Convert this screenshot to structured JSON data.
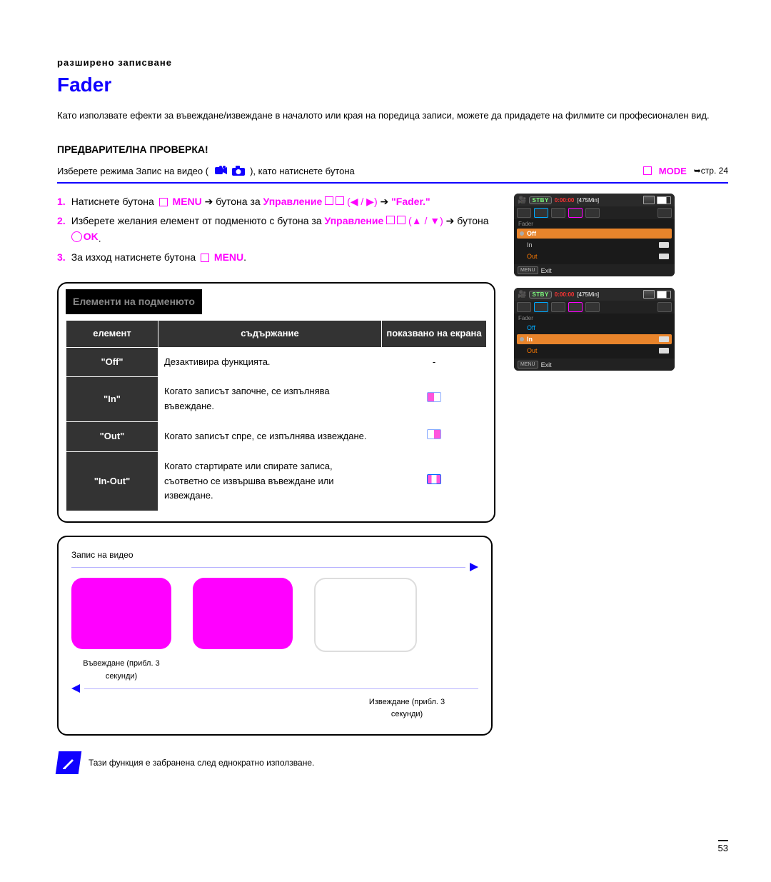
{
  "header": {
    "small_up": "разширено записване",
    "title": "Fader",
    "subtitle": "Като използвате ефекти за въвеждане/извеждане в началото или края на поредица записи, можете да придадете на филмите си професионален вид."
  },
  "precheck": {
    "label": "ПРЕДВАРИТЕЛНА ПРОВЕРКА!",
    "line": "Изберете режима Запис на видео (",
    "line_cont": "), като натиснете бутона",
    "mode_word": "MODE",
    "page_ref": "➥стр. 24"
  },
  "steps": [
    {
      "num": "1.",
      "pre": "Натиснете бутона",
      "menu": "MENU",
      "arrow_pre": "➔ бутона за",
      "ctrl": "Управление",
      "dirs": "(◀ / ▶)",
      "arrow_post": "➔",
      "target": "\"Fader.\""
    },
    {
      "num": "2.",
      "pre": "Изберете желания елемент от подменюто с бутона за",
      "ctrl": "Управление",
      "dirs": "(▲ / ▼)",
      "arrow": "➔ бутона",
      "ok": "OK"
    },
    {
      "num": "3.",
      "pre": "За изход натиснете бутона",
      "menu": "MENU",
      "post": "."
    }
  ],
  "submenu": {
    "title": "Елементи на подменюто",
    "head": {
      "c1": "елемент",
      "c2": "съдържание",
      "c3": "показвано на екрана"
    },
    "rows": [
      {
        "name": "\"Off\"",
        "desc": "Дезактивира функцията.",
        "icon": "none"
      },
      {
        "name": "\"In\"",
        "desc": "Когато записът започне, се изпълнява въвеждане.",
        "icon": "in"
      },
      {
        "name": "\"Out\"",
        "desc": "Когато записът спре, се изпълнява извеждане.",
        "icon": "out"
      },
      {
        "name": "\"In-Out\"",
        "desc": "Когато стартирате или спирате записа, съответно се извършва въвеждане или извеждане.",
        "icon": "inout"
      }
    ]
  },
  "illus": {
    "top_left": "Запис на видео",
    "fade_in_caption": "Въвеждане (прибл. 3 секунди)",
    "fade_out_caption": "Извеждане (прибл. 3 секунди)"
  },
  "note": "Тази функция е забранена след еднократно използване.",
  "page_number": "53",
  "screens": {
    "top": {
      "stby": "STBY",
      "time": "0:00:00",
      "min": "[475Min]",
      "header": "Fader",
      "items": [
        {
          "label": "Off",
          "checked": true,
          "sel": true,
          "cls": ""
        },
        {
          "label": "In",
          "checked": false,
          "sel": false,
          "cls": ""
        },
        {
          "label": "Out",
          "checked": false,
          "sel": false,
          "cls": "out"
        }
      ],
      "menu": "MENU",
      "exit": "Exit"
    },
    "bottom": {
      "stby": "STBY",
      "time": "0:00:00",
      "min": "[475Min]",
      "header": "Fader",
      "items": [
        {
          "label": "Off",
          "checked": false,
          "sel": false,
          "cls": "off-b"
        },
        {
          "label": "In",
          "checked": true,
          "sel": true,
          "cls": "in-b"
        },
        {
          "label": "Out",
          "checked": false,
          "sel": false,
          "cls": "out"
        }
      ],
      "menu": "MENU",
      "exit": "Exit"
    }
  }
}
